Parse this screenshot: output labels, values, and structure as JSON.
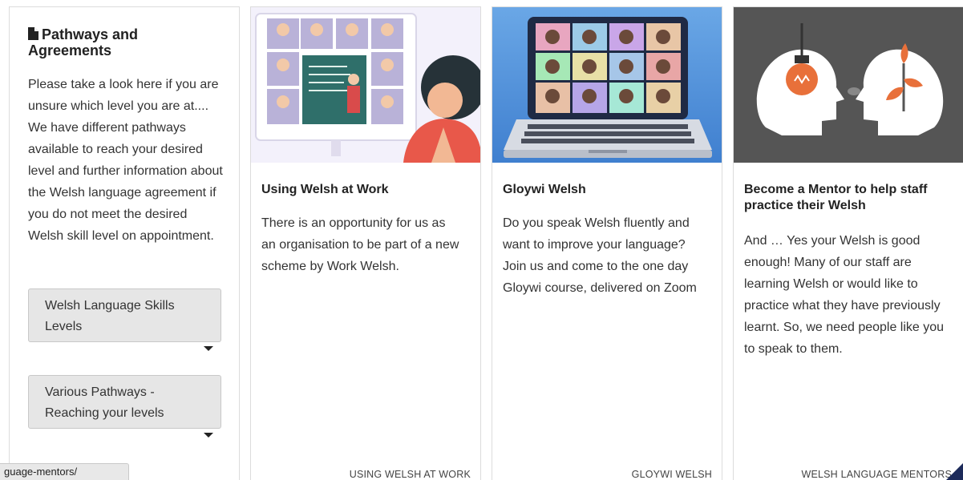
{
  "pathways": {
    "title": "Pathways and Agreements",
    "body": "Please take a look here if you are unsure which level you are at.... We have different pathways available to reach your desired level and further information about the Welsh language agreement if you do not meet the desired Welsh skill level on appointment.",
    "accordions": [
      {
        "label": "Welsh Language Skills Levels"
      },
      {
        "label": "Various Pathways - Reaching your levels"
      }
    ]
  },
  "cards": [
    {
      "title": "Using Welsh at Work",
      "text": "There is an opportunity for us as an organisation to be part of a new scheme by Work Welsh.",
      "link": "USING WELSH AT WORK",
      "image_icon": "video-call-teacher-illustration"
    },
    {
      "title": "Gloywi Welsh",
      "text": "Do you speak Welsh fluently and want to improve your language? Join us and come to the one day Gloywi course, delivered on Zoom",
      "link": "GLOYWI WELSH",
      "image_icon": "laptop-video-grid-illustration"
    },
    {
      "title": "Become a Mentor to help staff practice their Welsh",
      "text": "And … Yes your Welsh is good enough! Many of our staff are learning Welsh or would like to practice what they have previously learnt. So, we need people like you to speak to them.",
      "link": "WELSH LANGUAGE MENTORS",
      "image_icon": "mentor-heads-illustration"
    }
  ],
  "status_bar": {
    "url": "guage-mentors/"
  },
  "colors": {
    "accordion_bg": "#e6e6e6",
    "card_border": "#dcdcdc",
    "mentor_image_bg": "#555555",
    "laptop_image_bg": "#4a8fd6",
    "accent_orange": "#e8703a"
  }
}
